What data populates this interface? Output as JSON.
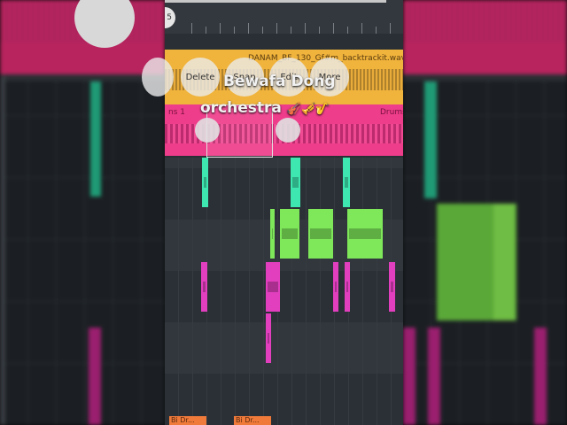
{
  "ruler": {
    "badge": "5"
  },
  "tracks": {
    "gold_clip_label": "DANAM_BF_130_Gf#m_backtrackit.wav",
    "pink_clip_left_label": "ns 1",
    "pink_clip_right_label": "Drums"
  },
  "context_menu": {
    "delete_label": "Delete",
    "snap_label": "Snap",
    "edit_label": "Edit",
    "more_label": "More"
  },
  "overlay": {
    "line1": "Bewafa Dong",
    "line2": "orchestra",
    "emoji_line": "🎻🎺🎷"
  },
  "bottom_clips": [
    "Bi Dr...",
    "Bi Dr..."
  ],
  "colors": {
    "gold": "#f0b33b",
    "pink": "#ee3d8a",
    "teal": "#3ee6b0",
    "green": "#7ee85a",
    "magenta": "#e23fbf",
    "orange": "#f07a3a"
  }
}
